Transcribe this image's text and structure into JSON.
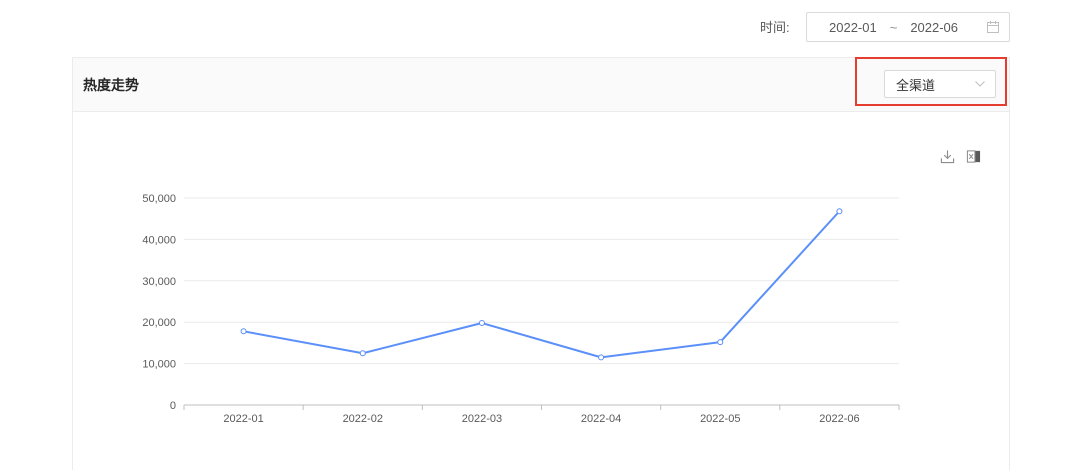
{
  "filter": {
    "time_label": "时间:",
    "start": "2022-01",
    "separator": "~",
    "end": "2022-06"
  },
  "panel": {
    "title": "热度走势",
    "channel_select": {
      "value": "全渠道"
    }
  },
  "icons": {
    "date_picker": "calendar-icon",
    "select": "chevron-down-icon",
    "download": "download-icon",
    "export": "excel-export-icon"
  },
  "colors": {
    "accent": "#5B8FF9",
    "highlight": "#E53E30",
    "grid": "#E9E9E9",
    "axis": "#BFBFBF"
  },
  "chart_data": {
    "type": "line",
    "categories": [
      "2022-01",
      "2022-02",
      "2022-03",
      "2022-04",
      "2022-05",
      "2022-06"
    ],
    "series": [
      {
        "values": [
          17800,
          12500,
          19800,
          11500,
          15200,
          46800
        ]
      }
    ],
    "yticks": [
      0,
      10000,
      20000,
      30000,
      40000,
      50000
    ],
    "ytick_labels": [
      "0",
      "10,000",
      "20,000",
      "30,000",
      "40,000",
      "50,000"
    ],
    "ylim": [
      0,
      50000
    ],
    "grid": true,
    "legend": "none"
  }
}
